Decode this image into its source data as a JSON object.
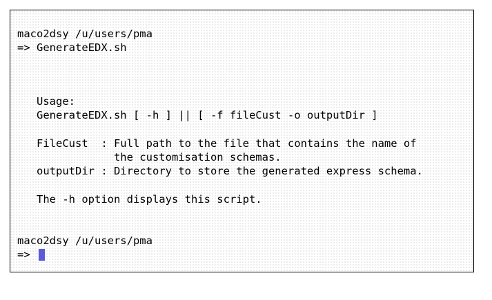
{
  "terminal": {
    "lines": [
      "maco2dsy /u/users/pma",
      "=> GenerateEDX.sh",
      "   Usage:",
      "   GenerateEDX.sh [ -h ] || [ -f fileCust -o outputDir ]",
      "   FileCust  : Full path to the file that contains the name of",
      "               the customisation schemas.",
      "   outputDir : Directory to store the generated express schema.",
      "   The -h option displays this script.",
      "maco2dsy /u/users/pma",
      "=> "
    ],
    "cursor_color": "#5a5ad8"
  }
}
